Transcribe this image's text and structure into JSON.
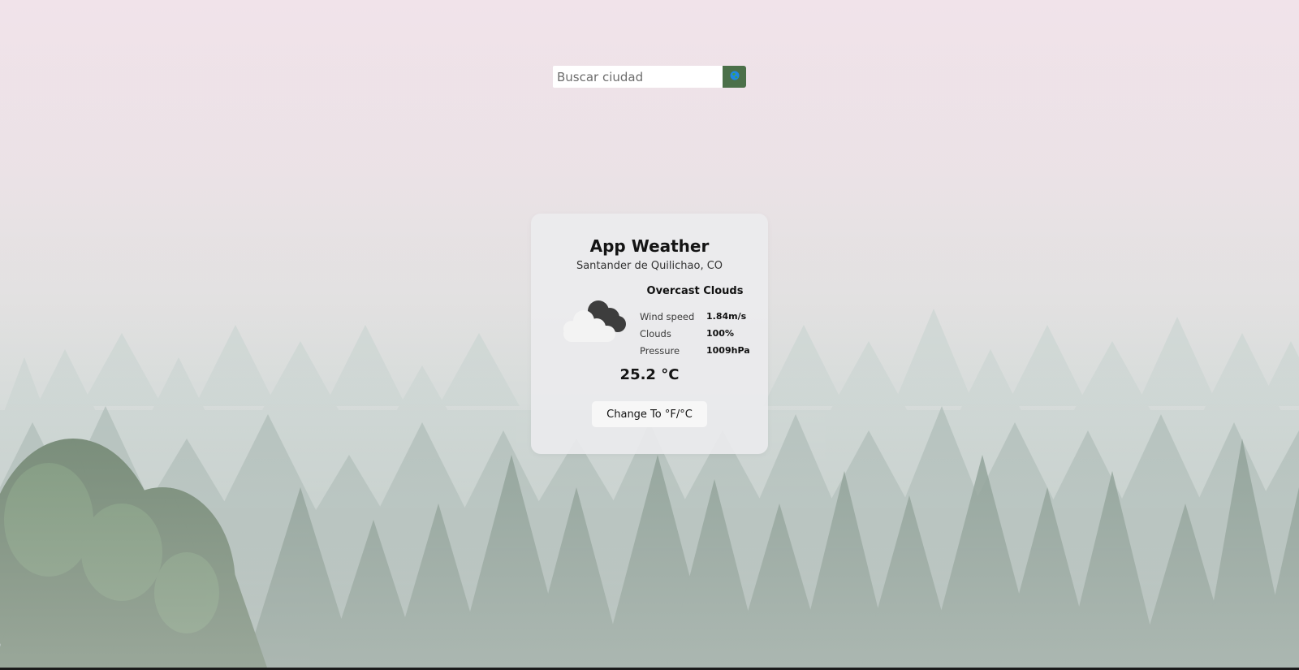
{
  "search": {
    "placeholder": "Buscar ciudad",
    "value": "",
    "button_icon": "globe-icon"
  },
  "card": {
    "title": "App Weather",
    "location": "Santander de Quilichao, CO",
    "condition_icon": "cloud-icon",
    "description": "Overcast Clouds",
    "stats": [
      {
        "label": "Wind speed",
        "value": "1.84m/s"
      },
      {
        "label": "Clouds",
        "value": "100%"
      },
      {
        "label": "Pressure",
        "value": "1009hPa"
      }
    ],
    "temperature": "25.2 °C",
    "unit_button_label": "Change To °F/°C"
  },
  "colors": {
    "search_button": "#4b7049",
    "card_background": "#ececee"
  }
}
